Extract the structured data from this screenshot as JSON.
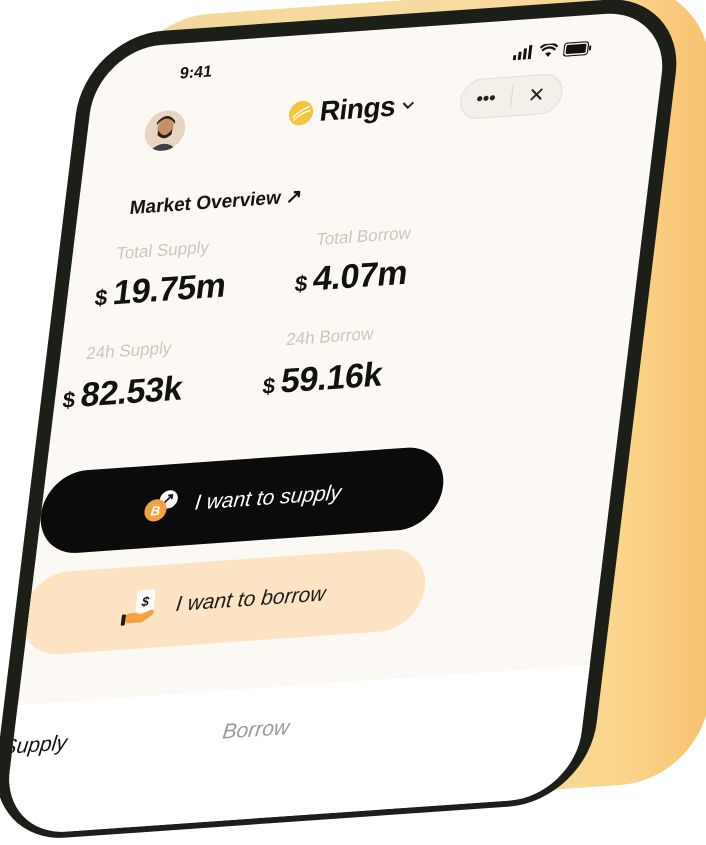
{
  "status_bar": {
    "time": "9:41"
  },
  "header": {
    "brand_name": "Rings"
  },
  "market": {
    "title": "Market Overview ↗",
    "total_supply_label": "Total Supply",
    "total_supply_value": "19.75m",
    "total_borrow_label": "Total Borrow",
    "total_borrow_value": "4.07m",
    "supply_24h_label": "24h Supply",
    "supply_24h_value": "82.53k",
    "borrow_24h_label": "24h Borrow",
    "borrow_24h_value": "59.16k",
    "currency_symbol": "$"
  },
  "actions": {
    "supply_label": "I want to supply",
    "borrow_label": "I want to borrow"
  },
  "tabs": {
    "supply": "Supply",
    "borrow": "Borrow"
  },
  "colors": {
    "brand_yellow": "#f4c43a",
    "primary_button": "#0b0b0b",
    "secondary_button": "#fbe3c3",
    "screen_bg": "#fcf8f3",
    "coin_orange": "#f0a340"
  }
}
